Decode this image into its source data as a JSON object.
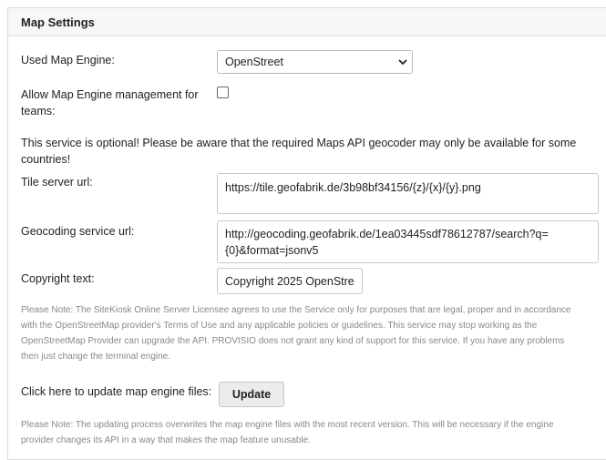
{
  "panel": {
    "title": "Map Settings"
  },
  "engine": {
    "label": "Used Map Engine:",
    "selected": "OpenStreet",
    "icon": "chevron-down-icon"
  },
  "teams": {
    "label_line1": "Allow Map Engine management for",
    "label_line2": "teams:",
    "checked": false
  },
  "service_notice": {
    "line1": "This service is optional! Please be aware that the required Maps API geocoder may only be available for some",
    "line2": "countries!"
  },
  "tile_server": {
    "label": "Tile server url:",
    "value": "https://tile.geofabrik.de/3b98bf34156/{z}/{x}/{y}.png"
  },
  "geocoding": {
    "label": "Geocoding service url:",
    "value_line1": "http://geocoding.geofabrik.de/1ea03445sdf78612787/search?q=",
    "value_line2": "{0}&format=jsonv5"
  },
  "copyright": {
    "label": "Copyright text:",
    "value": "Copyright 2025 OpenStre"
  },
  "license_note": {
    "line1": "Please Note: The SiteKiosk Online Server Licensee agrees to use the Service only for purposes that are legal, proper and in accordance",
    "line2": "with the OpenStreetMap provider's Terms of Use and any applicable policies or guidelines. This service may stop working as the",
    "line3": "OpenStreetMap Provider can upgrade the API. PROVISIO does not grant any kind of support for this service. If you have any problems",
    "line4": "then just change the terminal engine."
  },
  "update": {
    "label": "Click here to update map engine files:",
    "button": "Update"
  },
  "update_note": {
    "line1": "Please Note: The updating process overwrites the map engine files with the most recent version. This will be necessary if the engine",
    "line2": "provider changes its API in a way that makes the map feature unusable."
  }
}
